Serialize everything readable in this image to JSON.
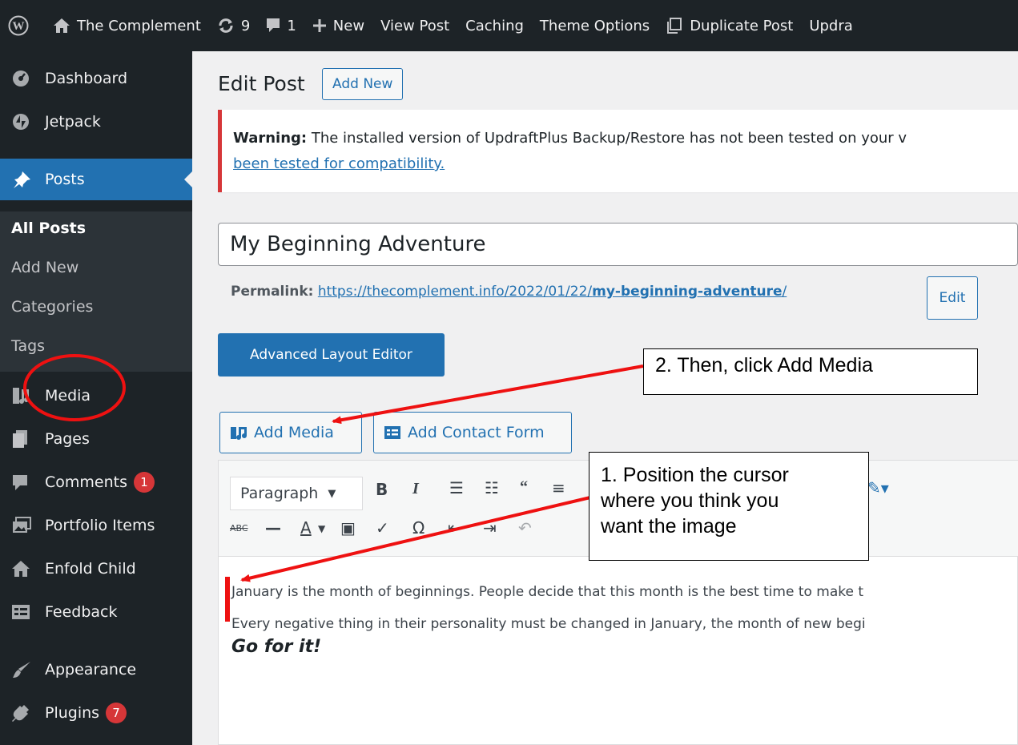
{
  "admin_bar": {
    "site_name": "The Complement",
    "updates_count": "9",
    "comments_count": "1",
    "new_label": "New",
    "view_post_label": "View Post",
    "caching_label": "Caching",
    "theme_options_label": "Theme Options",
    "duplicate_post_label": "Duplicate Post",
    "updraft_label": "Updra"
  },
  "sidebar": {
    "dashboard": "Dashboard",
    "jetpack": "Jetpack",
    "posts": "Posts",
    "submenu": {
      "all_posts": "All Posts",
      "add_new": "Add New",
      "categories": "Categories",
      "tags": "Tags"
    },
    "media": "Media",
    "pages": "Pages",
    "comments": "Comments",
    "comments_badge": "1",
    "portfolio": "Portfolio Items",
    "enfold": "Enfold Child",
    "feedback": "Feedback",
    "appearance": "Appearance",
    "plugins": "Plugins",
    "plugins_badge": "7"
  },
  "page": {
    "title": "Edit Post",
    "add_new": "Add New"
  },
  "notice": {
    "strong": "Warning:",
    "text": " The installed version of UpdraftPlus Backup/Restore has not been tested on your v",
    "link": "been tested for compatibility."
  },
  "post": {
    "title": "My Beginning Adventure",
    "permalink_label": "Permalink:",
    "permalink_base": "https://thecomplement.info/2022/01/22/",
    "permalink_slug": "my-beginning-adventure",
    "permalink_tail": "/",
    "edit_label": "Edit"
  },
  "buttons": {
    "advanced_layout": "Advanced Layout Editor",
    "add_media": "Add Media",
    "add_contact_form": "Add Contact Form"
  },
  "editor": {
    "format_value": "Paragraph",
    "para1": "January is the month of beginnings. People decide that this month is the best time to make t",
    "para2": "Every negative thing in their personality must be changed in January, the month of new begi",
    "heading": "Go for it!"
  },
  "annotations": {
    "callout_1": [
      "1.  Position the cursor",
      "where you think you",
      "want the image"
    ],
    "callout_2": "2.  Then, click Add Media",
    "color": "#ee1111"
  }
}
